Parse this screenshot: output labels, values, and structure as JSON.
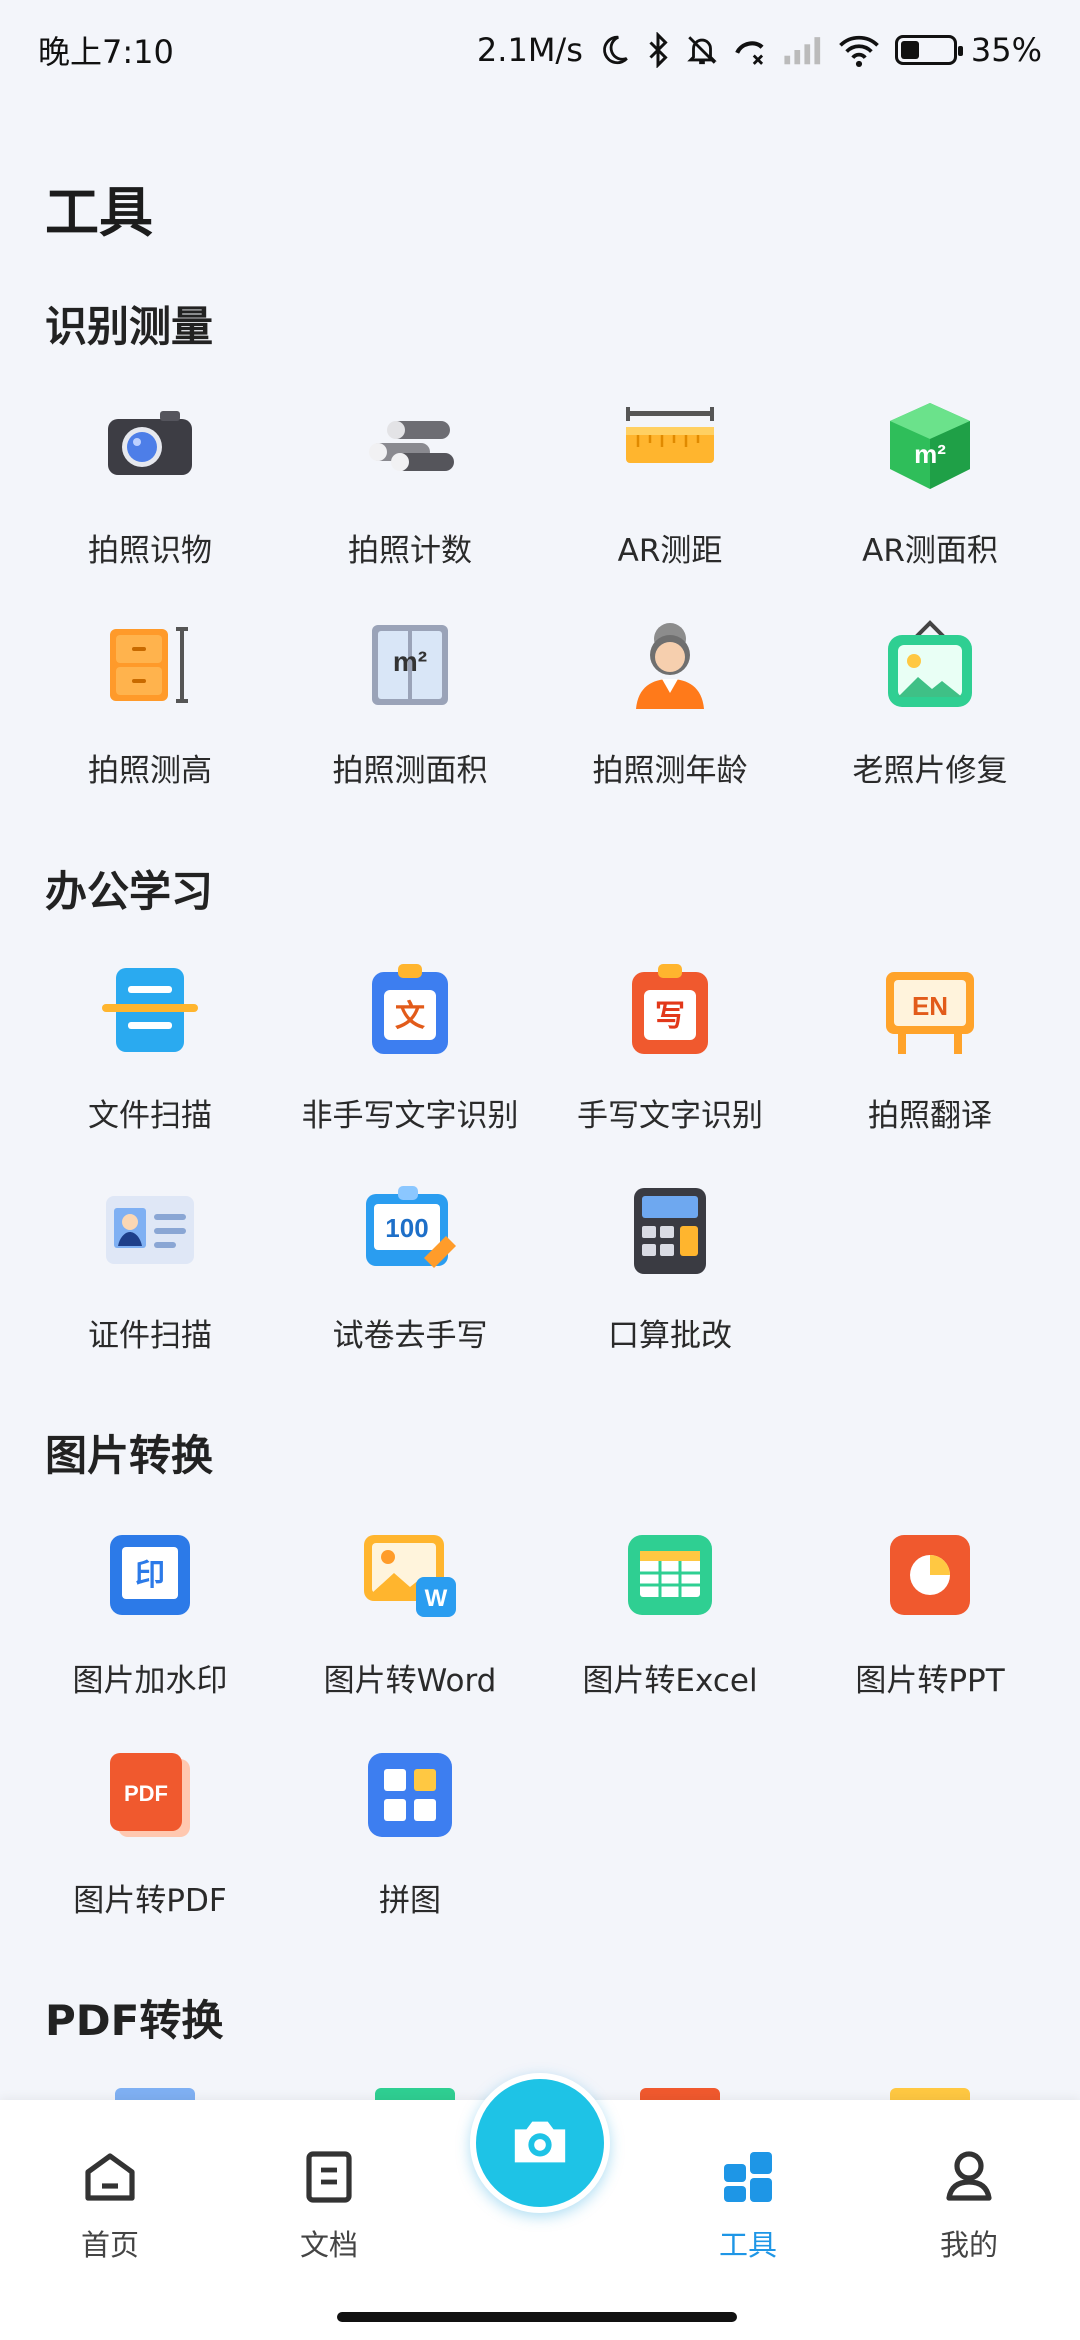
{
  "status": {
    "time": "晚上7:10",
    "speed": "2.1M/s",
    "battery": "35%",
    "icons": [
      "moon-icon",
      "bluetooth-icon",
      "mute-bell-icon",
      "call-forward-icon",
      "signal-icon",
      "wifi-icon",
      "battery-icon"
    ]
  },
  "page": {
    "title": "工具"
  },
  "sections": [
    {
      "title": "识别测量",
      "tools": [
        {
          "label": "拍照识物",
          "icon": "camera-icon"
        },
        {
          "label": "拍照计数",
          "icon": "pipes-icon"
        },
        {
          "label": "AR测距",
          "icon": "ruler-icon"
        },
        {
          "label": "AR测面积",
          "icon": "cube-area-icon"
        },
        {
          "label": "拍照测高",
          "icon": "cabinet-height-icon"
        },
        {
          "label": "拍照测面积",
          "icon": "window-area-icon"
        },
        {
          "label": "拍照测年龄",
          "icon": "person-age-icon"
        },
        {
          "label": "老照片修复",
          "icon": "photo-frame-icon"
        }
      ]
    },
    {
      "title": "办公学习",
      "tools": [
        {
          "label": "文件扫描",
          "icon": "document-scan-icon"
        },
        {
          "label": "非手写文字识别",
          "icon": "text-recognition-icon"
        },
        {
          "label": "手写文字识别",
          "icon": "handwriting-recognition-icon"
        },
        {
          "label": "拍照翻译",
          "icon": "translate-board-icon"
        },
        {
          "label": "证件扫描",
          "icon": "id-card-icon"
        },
        {
          "label": "试卷去手写",
          "icon": "exam-paper-icon"
        },
        {
          "label": "口算批改",
          "icon": "calculator-icon"
        }
      ]
    },
    {
      "title": "图片转换",
      "tools": [
        {
          "label": "图片加水印",
          "icon": "watermark-icon"
        },
        {
          "label": "图片转Word",
          "icon": "image-to-word-icon"
        },
        {
          "label": "图片转Excel",
          "icon": "image-to-excel-icon"
        },
        {
          "label": "图片转PPT",
          "icon": "image-to-ppt-icon"
        },
        {
          "label": "图片转PDF",
          "icon": "image-to-pdf-icon"
        },
        {
          "label": "拼图",
          "icon": "collage-icon"
        }
      ]
    },
    {
      "title": "PDF转换",
      "tools": []
    }
  ],
  "icon_text": {
    "id_stamp": "印",
    "en": "EN",
    "wen": "文",
    "xie": "写",
    "hundred": "100",
    "m2": "m²",
    "w": "W",
    "pdf": "PDF"
  },
  "nav": {
    "items": [
      {
        "label": "首页",
        "icon": "home-icon"
      },
      {
        "label": "文档",
        "icon": "document-icon"
      },
      {
        "label": "工具",
        "icon": "grid-icon",
        "active": true
      },
      {
        "label": "我的",
        "icon": "user-icon"
      }
    ],
    "fab_icon": "camera-icon"
  },
  "colors": {
    "accent": "#1e96e6",
    "fab": "#1ec3e6",
    "background": "#f3f5fa"
  }
}
